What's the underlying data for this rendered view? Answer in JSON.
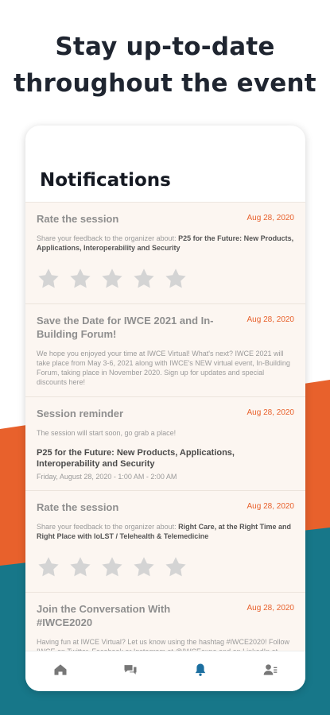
{
  "headline": {
    "line1": "Stay up-to-date",
    "line2": "throughout the event"
  },
  "screen": {
    "title": "Notifications"
  },
  "notifications": [
    {
      "title": "Rate the session",
      "date": "Aug 28, 2020",
      "body_prefix": "Share your feedback to the organizer about:",
      "body_bold": "P25 for the Future: New Products, Applications, Interoperability and Security",
      "rating": 0,
      "stars": 5
    },
    {
      "title": "Save the Date for IWCE 2021 and In-Building Forum!",
      "date": "Aug 28, 2020",
      "body": "We hope you enjoyed your time at IWCE Virtual! What's next? IWCE 2021 will take place from May 3-6, 2021 along with IWCE's NEW virtual event, In-Building Forum, taking place in November 2020. Sign up for updates and special discounts here!"
    },
    {
      "title": "Session reminder",
      "date": "Aug 28, 2020",
      "body": "The session will start soon, go grab a place!",
      "session_name": "P25 for the Future: New Products, Applications, Interoperability and Security",
      "session_time": "Friday, August 28, 2020 - 1:00 AM - 2:00 AM"
    },
    {
      "title": "Rate the session",
      "date": "Aug 28, 2020",
      "body_prefix": "Share your feedback to the organizer about:",
      "body_bold": "Right Care, at the Right Time and Right Place with IoLST / Telehealth & Telemedicine",
      "rating": 0,
      "stars": 5
    },
    {
      "title": "Join the Conversation With #IWCE2020",
      "date": "Aug 28, 2020",
      "body": "Having fun at IWCE Virtual? Let us know using the hashtag #IWCE2020! Follow IWCE on Twitter, Facebook or Instagram at @IWCEexpo and on LinkedIn at @IWCE. Share your favorite parts of the show, upload photos and videos and continue discussions from the event."
    }
  ],
  "tabs": [
    {
      "name": "home",
      "icon": "home-icon"
    },
    {
      "name": "chat",
      "icon": "chat-icon"
    },
    {
      "name": "notifications",
      "icon": "bell-icon",
      "active": true
    },
    {
      "name": "profile",
      "icon": "profile-icon"
    }
  ],
  "colors": {
    "accent_orange": "#e8612c",
    "accent_teal": "#177789",
    "active_tab": "#1c6fa0",
    "inactive_tab": "#777777",
    "star": "#d4d4d4"
  }
}
